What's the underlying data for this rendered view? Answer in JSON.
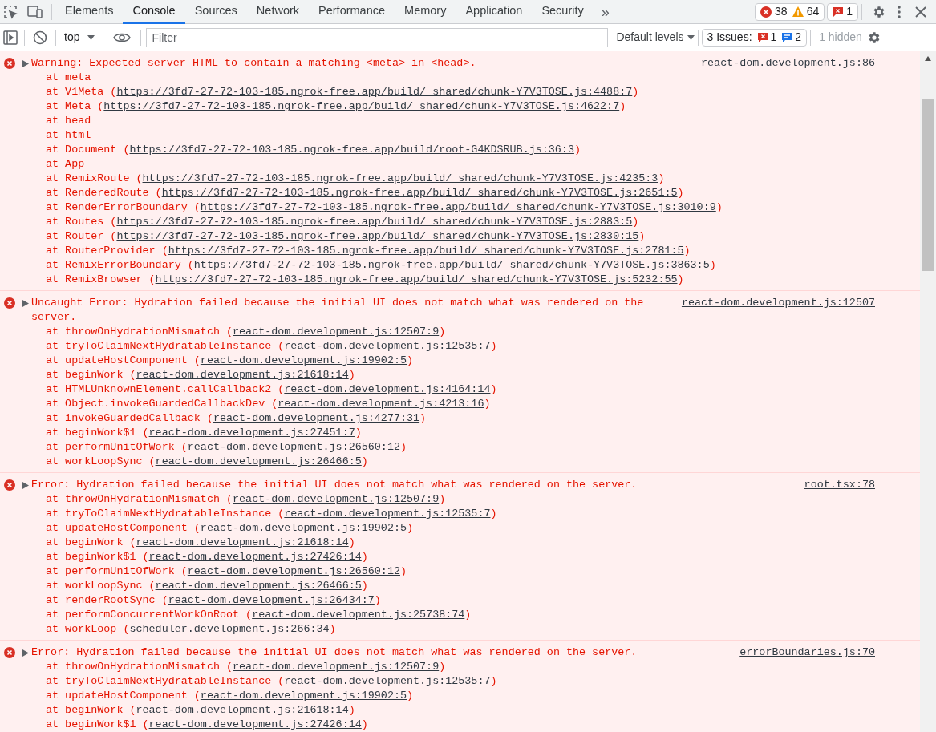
{
  "tabs": [
    {
      "label": "Elements",
      "selected": false
    },
    {
      "label": "Console",
      "selected": true
    },
    {
      "label": "Sources",
      "selected": false
    },
    {
      "label": "Network",
      "selected": false
    },
    {
      "label": "Performance",
      "selected": false
    },
    {
      "label": "Memory",
      "selected": false
    },
    {
      "label": "Application",
      "selected": false
    },
    {
      "label": "Security",
      "selected": false
    }
  ],
  "more_tabs": "»",
  "counters": [
    {
      "kind": "error",
      "count": "38"
    },
    {
      "kind": "warning",
      "count": "64"
    },
    {
      "kind": "issue",
      "count": "1"
    }
  ],
  "console_toolbar": {
    "context": "top",
    "filter": {
      "placeholder": "Filter"
    },
    "levels": "Default levels",
    "issues": {
      "label": "3 Issues:",
      "counts": [
        {
          "kind": "issue",
          "count": "1"
        },
        {
          "kind": "info",
          "count": "2"
        }
      ]
    },
    "hidden": "1 hidden"
  },
  "messages": [
    {
      "kind": "error",
      "expanded": false,
      "text": "Warning: Expected server HTML to contain a matching <meta> in <head>.",
      "source": "react-dom.development.js:86",
      "frames": [
        {
          "text": "at meta"
        },
        {
          "text": "at V1Meta (",
          "link": "https://3fd7-27-72-103-185.ngrok-free.app/build/_shared/chunk-Y7V3TOSE.js:4488:7",
          "tail": ")"
        },
        {
          "text": "at Meta (",
          "link": "https://3fd7-27-72-103-185.ngrok-free.app/build/_shared/chunk-Y7V3TOSE.js:4622:7",
          "tail": ")"
        },
        {
          "text": "at head"
        },
        {
          "text": "at html"
        },
        {
          "text": "at Document (",
          "link": "https://3fd7-27-72-103-185.ngrok-free.app/build/root-G4KDSRUB.js:36:3",
          "tail": ")"
        },
        {
          "text": "at App"
        },
        {
          "text": "at RemixRoute (",
          "link": "https://3fd7-27-72-103-185.ngrok-free.app/build/_shared/chunk-Y7V3TOSE.js:4235:3",
          "tail": ")"
        },
        {
          "text": "at RenderedRoute (",
          "link": "https://3fd7-27-72-103-185.ngrok-free.app/build/_shared/chunk-Y7V3TOSE.js:2651:5",
          "tail": ")"
        },
        {
          "text": "at RenderErrorBoundary (",
          "link": "https://3fd7-27-72-103-185.ngrok-free.app/build/_shared/chunk-Y7V3TOSE.js:3010:9",
          "tail": ")"
        },
        {
          "text": "at Routes (",
          "link": "https://3fd7-27-72-103-185.ngrok-free.app/build/_shared/chunk-Y7V3TOSE.js:2883:5",
          "tail": ")"
        },
        {
          "text": "at Router (",
          "link": "https://3fd7-27-72-103-185.ngrok-free.app/build/_shared/chunk-Y7V3TOSE.js:2830:15",
          "tail": ")"
        },
        {
          "text": "at RouterProvider (",
          "link": "https://3fd7-27-72-103-185.ngrok-free.app/build/_shared/chunk-Y7V3TOSE.js:2781:5",
          "tail": ")"
        },
        {
          "text": "at RemixErrorBoundary (",
          "link": "https://3fd7-27-72-103-185.ngrok-free.app/build/_shared/chunk-Y7V3TOSE.js:3863:5",
          "tail": ")"
        },
        {
          "text": "at RemixBrowser (",
          "link": "https://3fd7-27-72-103-185.ngrok-free.app/build/_shared/chunk-Y7V3TOSE.js:5232:55",
          "tail": ")"
        }
      ]
    },
    {
      "kind": "error",
      "expanded": false,
      "text": "Uncaught Error: Hydration failed because the initial UI does not match what was rendered on the server.",
      "source": "react-dom.development.js:12507",
      "frames": [
        {
          "text": "at throwOnHydrationMismatch (",
          "link": "react-dom.development.js:12507:9",
          "tail": ")"
        },
        {
          "text": "at tryToClaimNextHydratableInstance (",
          "link": "react-dom.development.js:12535:7",
          "tail": ")"
        },
        {
          "text": "at updateHostComponent (",
          "link": "react-dom.development.js:19902:5",
          "tail": ")"
        },
        {
          "text": "at beginWork (",
          "link": "react-dom.development.js:21618:14",
          "tail": ")"
        },
        {
          "text": "at HTMLUnknownElement.callCallback2 (",
          "link": "react-dom.development.js:4164:14",
          "tail": ")"
        },
        {
          "text": "at Object.invokeGuardedCallbackDev (",
          "link": "react-dom.development.js:4213:16",
          "tail": ")"
        },
        {
          "text": "at invokeGuardedCallback (",
          "link": "react-dom.development.js:4277:31",
          "tail": ")"
        },
        {
          "text": "at beginWork$1 (",
          "link": "react-dom.development.js:27451:7",
          "tail": ")"
        },
        {
          "text": "at performUnitOfWork (",
          "link": "react-dom.development.js:26560:12",
          "tail": ")"
        },
        {
          "text": "at workLoopSync (",
          "link": "react-dom.development.js:26466:5",
          "tail": ")"
        }
      ]
    },
    {
      "kind": "error",
      "expanded": false,
      "text": "Error: Hydration failed because the initial UI does not match what was rendered on the server.",
      "source": "root.tsx:78",
      "frames": [
        {
          "text": "at throwOnHydrationMismatch (",
          "link": "react-dom.development.js:12507:9",
          "tail": ")"
        },
        {
          "text": "at tryToClaimNextHydratableInstance (",
          "link": "react-dom.development.js:12535:7",
          "tail": ")"
        },
        {
          "text": "at updateHostComponent (",
          "link": "react-dom.development.js:19902:5",
          "tail": ")"
        },
        {
          "text": "at beginWork (",
          "link": "react-dom.development.js:21618:14",
          "tail": ")"
        },
        {
          "text": "at beginWork$1 (",
          "link": "react-dom.development.js:27426:14",
          "tail": ")"
        },
        {
          "text": "at performUnitOfWork (",
          "link": "react-dom.development.js:26560:12",
          "tail": ")"
        },
        {
          "text": "at workLoopSync (",
          "link": "react-dom.development.js:26466:5",
          "tail": ")"
        },
        {
          "text": "at renderRootSync (",
          "link": "react-dom.development.js:26434:7",
          "tail": ")"
        },
        {
          "text": "at performConcurrentWorkOnRoot (",
          "link": "react-dom.development.js:25738:74",
          "tail": ")"
        },
        {
          "text": "at workLoop (",
          "link": "scheduler.development.js:266:34",
          "tail": ")"
        }
      ]
    },
    {
      "kind": "error",
      "expanded": false,
      "text": "Error: Hydration failed because the initial UI does not match what was rendered on the server.",
      "source": "errorBoundaries.js:70",
      "frames": [
        {
          "text": "at throwOnHydrationMismatch (",
          "link": "react-dom.development.js:12507:9",
          "tail": ")"
        },
        {
          "text": "at tryToClaimNextHydratableInstance (",
          "link": "react-dom.development.js:12535:7",
          "tail": ")"
        },
        {
          "text": "at updateHostComponent (",
          "link": "react-dom.development.js:19902:5",
          "tail": ")"
        },
        {
          "text": "at beginWork (",
          "link": "react-dom.development.js:21618:14",
          "tail": ")"
        },
        {
          "text": "at beginWork$1 (",
          "link": "react-dom.development.js:27426:14",
          "tail": ")"
        }
      ]
    }
  ]
}
